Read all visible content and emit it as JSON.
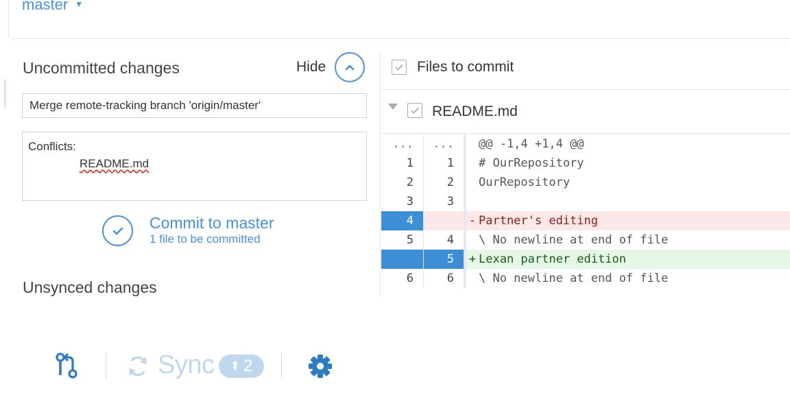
{
  "branch": {
    "name": "master"
  },
  "uncommitted": {
    "title": "Uncommitted changes",
    "hide_label": "Hide",
    "summary_value": "Merge remote-tracking branch 'origin/master'",
    "description_heading": "Conflicts:",
    "description_file": "README.md",
    "commit_label": "Commit to master",
    "commit_sub": "1 file to be committed"
  },
  "unsynced": {
    "title": "Unsynced changes"
  },
  "files": {
    "header_label": "Files to commit",
    "file_name": "README.md"
  },
  "diff": {
    "rows": [
      {
        "type": "hunk",
        "old": "...",
        "new": "...",
        "sign": "",
        "text": "@@ -1,4 +1,4 @@"
      },
      {
        "type": "ctx",
        "old": "1",
        "new": "1",
        "sign": "",
        "text": "# OurRepository"
      },
      {
        "type": "ctx",
        "old": "2",
        "new": "2",
        "sign": "",
        "text": "OurRepository"
      },
      {
        "type": "ctx",
        "old": "3",
        "new": "3",
        "sign": "",
        "text": ""
      },
      {
        "type": "del",
        "old": "4",
        "new": "",
        "sign": "-",
        "text": "Partner's editing"
      },
      {
        "type": "ctx",
        "old": "5",
        "new": "4",
        "sign": "",
        "text": "\\ No newline at end of file"
      },
      {
        "type": "add",
        "old": "",
        "new": "5",
        "sign": "+",
        "text": "Lexan partner edition"
      },
      {
        "type": "ctx",
        "old": "6",
        "new": "6",
        "sign": "",
        "text": "\\ No newline at end of file"
      }
    ]
  },
  "bottom_bar": {
    "sync_label": "Sync",
    "sync_badge_count": "2",
    "icons": [
      "pull-request-icon",
      "sync-icon",
      "up-arrow-icon",
      "gear-icon"
    ]
  },
  "colors": {
    "accent": "#4a90d9",
    "deleted_bg": "#fde8e8",
    "added_bg": "#e6f7e6",
    "line_highlight": "#3c8fd6",
    "sync_disabled": "#c0d8ee"
  }
}
